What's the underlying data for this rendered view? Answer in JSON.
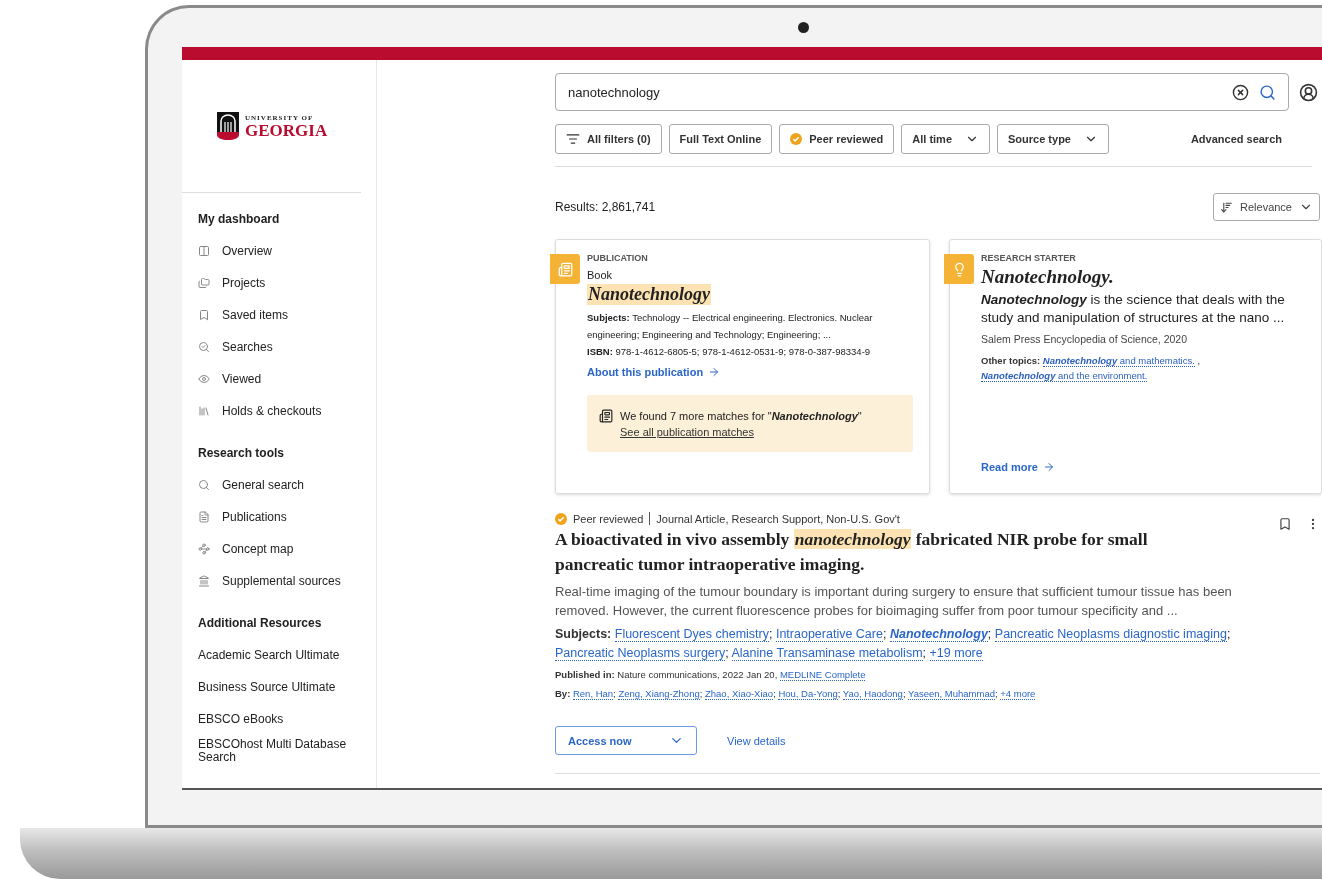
{
  "sidebar": {
    "logo": {
      "line1": "UNIVERSITY OF",
      "line2": "GEORGIA"
    },
    "sections": [
      {
        "kind": "icons",
        "heading": "My dashboard",
        "items": [
          "Overview",
          "Projects",
          "Saved items",
          "Searches",
          "Viewed",
          "Holds & checkouts"
        ]
      },
      {
        "kind": "tools",
        "heading": "Research tools",
        "items": [
          "General search",
          "Publications",
          "Concept map",
          "Supplemental sources"
        ]
      },
      {
        "kind": "plain",
        "heading": "Additional Resources",
        "items": [
          "Academic Search Ultimate",
          "Business Source Ultimate",
          "EBSCO eBooks",
          "EBSCOhost Multi Database Search"
        ]
      }
    ]
  },
  "search": {
    "value": "nanotechnology"
  },
  "filters": [
    {
      "label": "All filters (0)",
      "kind": "filter"
    },
    {
      "label": "Full Text Online",
      "kind": "plain"
    },
    {
      "label": "Peer reviewed",
      "kind": "badge"
    },
    {
      "label": "All time",
      "kind": "dropdown"
    },
    {
      "label": "Source type",
      "kind": "dropdown"
    }
  ],
  "advanced_search": "Advanced search",
  "results_count": "Results: 2,861,741",
  "sort": {
    "label": "Relevance"
  },
  "publication_card": {
    "category": "PUBLICATION",
    "type": "Book",
    "title": "Nanotechnology",
    "subjects_label": "Subjects:",
    "subjects": "Technology -- Electrical engineering. Electronics. Nuclear engineering; Engineering and Technology; Engineering; ...",
    "isbn_label": "ISBN:",
    "isbn": "978-1-4612-6805-5; 978-1-4612-0531-9; 978-0-387-98334-9",
    "link": "About this publication",
    "notice": "We found 7 more matches for \"**Nanotechnology**\"",
    "notice_link": "See all publication matches"
  },
  "research_starter": {
    "category": "RESEARCH STARTER",
    "title": "Nanotechnology.",
    "summary": "**Nanotechnology** is the science that deals with the study and manipulation of structures at the nano ...",
    "source": "Salem Press Encyclopedia of Science, 2020",
    "topics_label": "Other topics:",
    "topics": [
      "**Nanotechnology** and mathematics.",
      "**Nanotechnology** and the environment."
    ],
    "separator": ",",
    "link": "Read more"
  },
  "results": [
    {
      "badge": "Peer reviewed",
      "type": "Journal Article, Research Support, Non-U.S. Gov't",
      "title": "A bioactivated in vivo assembly *nanotechnology* fabricated NIR probe for small pancreatic tumor intraoperative imaging.",
      "abstract": "Real-time imaging of the tumour boundary is important during surgery to ensure that sufficient tumour tissue has been removed. However, the current fluorescence probes for bioimaging suffer from poor tumour specificity and ...",
      "subjects_label": "Subjects:",
      "subjects": [
        "Fluorescent Dyes chemistry",
        "Intraoperative Care",
        "**Nanotechnology**",
        "Pancreatic Neoplasms diagnostic imaging",
        "Pancreatic Neoplasms surgery",
        "Alanine Transaminase metabolism"
      ],
      "subjects_more": "+19 more",
      "list_separator": ";",
      "published_label": "Published in:",
      "published": "Nature communications, 2022 Jan 20,",
      "database": "MEDLINE Complete",
      "by_label": "By:",
      "authors": [
        "Ren, Han",
        "Zeng, Xiang-Zhong",
        "Zhao, Xiao-Xiao",
        "Hou, Da-Yong",
        "Yao, Haodong",
        "Yaseen, Muhammad"
      ],
      "authors_more": "+4 more",
      "access": "Access now",
      "details": "View details"
    }
  ]
}
